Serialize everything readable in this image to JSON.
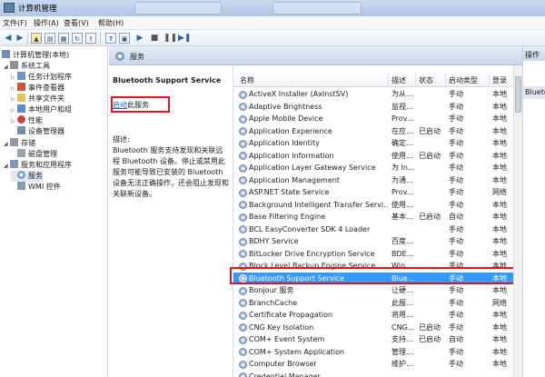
{
  "window": {
    "title": "计算机管理"
  },
  "menu": [
    "文件(F)",
    "操作(A)",
    "查看(V)",
    "帮助(H)"
  ],
  "tree": [
    {
      "label": "计算机管理(本地)",
      "level": 0,
      "icon": "computer-icon"
    },
    {
      "label": "系统工具",
      "level": 1,
      "icon": "tools-icon"
    },
    {
      "label": "任务计划程序",
      "level": 2,
      "icon": "task-scheduler-icon"
    },
    {
      "label": "事件查看器",
      "level": 2,
      "icon": "event-viewer-icon"
    },
    {
      "label": "共享文件夹",
      "level": 2,
      "icon": "shared-folder-icon"
    },
    {
      "label": "本地用户和组",
      "level": 2,
      "icon": "users-icon"
    },
    {
      "label": "性能",
      "level": 2,
      "icon": "performance-icon"
    },
    {
      "label": "设备管理器",
      "level": 2,
      "icon": "device-manager-icon"
    },
    {
      "label": "存储",
      "level": 1,
      "icon": "storage-icon"
    },
    {
      "label": "磁盘管理",
      "level": 2,
      "icon": "disk-icon"
    },
    {
      "label": "服务和应用程序",
      "level": 1,
      "icon": "apps-icon"
    },
    {
      "label": "服务",
      "level": 2,
      "icon": "services-icon"
    },
    {
      "label": "WMI 控件",
      "level": 2,
      "icon": "wmi-icon"
    }
  ],
  "services_panel": {
    "header": "服务",
    "selected_name": "Bluetooth Support Service",
    "start_link_prefix": "启动",
    "start_link_suffix": "此服务",
    "desc_label": "描述:",
    "description": "Bluetooth 服务支持发现和关联远程 Bluetooth 设备。停止或禁用此服务可能导致已安装的 Bluetooth 设备无法正确操作，还会阻止发现和关联新设备。"
  },
  "columns": [
    "名称",
    "描述",
    "状态",
    "启动类型",
    "登录"
  ],
  "services": [
    [
      "ActiveX Installer (AxInstSV)",
      "为从...",
      "",
      "手动",
      "本地"
    ],
    [
      "Adaptive Brightness",
      "监视...",
      "",
      "手动",
      "本地"
    ],
    [
      "Apple Mobile Device",
      "Prov...",
      "",
      "手动",
      "本地"
    ],
    [
      "Application Experience",
      "在应...",
      "已启动",
      "手动",
      "本地"
    ],
    [
      "Application Identity",
      "确定...",
      "",
      "手动",
      "本地"
    ],
    [
      "Application Information",
      "使用...",
      "已启动",
      "手动",
      "本地"
    ],
    [
      "Application Layer Gateway Service",
      "为 In...",
      "",
      "手动",
      "本地"
    ],
    [
      "Application Management",
      "为通...",
      "",
      "手动",
      "本地"
    ],
    [
      "ASP.NET State Service",
      "Prov...",
      "",
      "手动",
      "网络"
    ],
    [
      "Background Intelligent Transfer Servi...",
      "使用...",
      "",
      "手动",
      "本地"
    ],
    [
      "Base Filtering Engine",
      "基本...",
      "已启动",
      "自动",
      "本地"
    ],
    [
      "BCL EasyConverter SDK 4 Loader",
      "",
      "",
      "手动",
      "本地"
    ],
    [
      "BDHY Service",
      "百度...",
      "",
      "手动",
      "本地"
    ],
    [
      "BitLocker Drive Encryption Service",
      "BDE...",
      "",
      "手动",
      "本地"
    ],
    [
      "Block Level Backup Engine Service",
      "Win...",
      "",
      "手动",
      "本地"
    ],
    [
      "Bluetooth Support Service",
      "Blue...",
      "",
      "手动",
      "本地"
    ],
    [
      "Bonjour 服务",
      "让硬...",
      "",
      "手动",
      "本地"
    ],
    [
      "BranchCache",
      "此服...",
      "",
      "手动",
      "网络"
    ],
    [
      "Certificate Propagation",
      "将用...",
      "",
      "手动",
      "本地"
    ],
    [
      "CNG Key Isolation",
      "CNG...",
      "已启动",
      "手动",
      "本地"
    ],
    [
      "COM+ Event System",
      "支持...",
      "已启动",
      "自动",
      "本地"
    ],
    [
      "COM+ System Application",
      "管理...",
      "",
      "手动",
      "本地"
    ],
    [
      "Computer Browser",
      "维护...",
      "",
      "手动",
      "本地"
    ],
    [
      "Credential Manager",
      "",
      "",
      "",
      ""
    ]
  ],
  "selected_index": 15,
  "actions": {
    "header": "操作",
    "sub": "Blueto"
  },
  "colors": {
    "selection": "#3399ff",
    "highlight_border": "#e3131b",
    "link": "#1d62c8"
  }
}
